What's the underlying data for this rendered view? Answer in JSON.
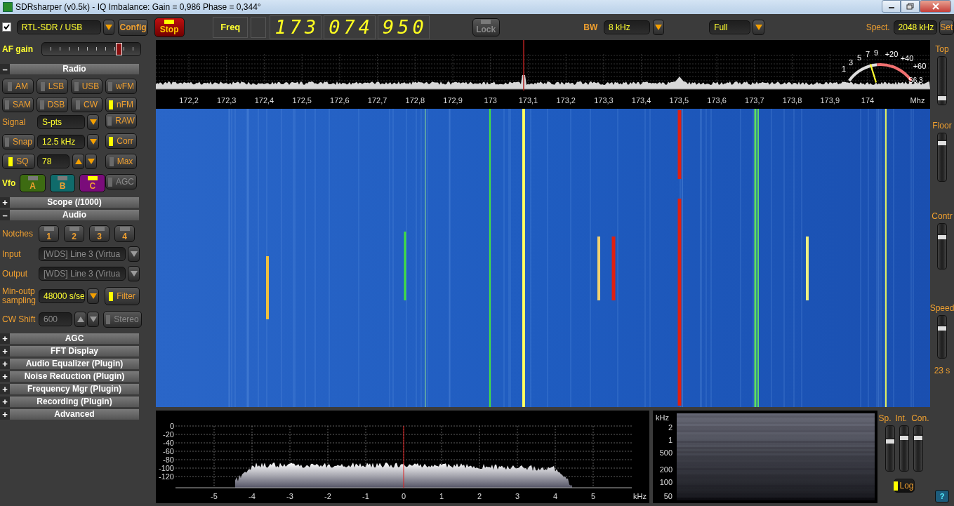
{
  "window": {
    "title": "SDRsharper (v0.5k) - IQ Imbalance: Gain = 0,986 Phase = 0,344°"
  },
  "toolbar": {
    "source_checked": true,
    "source": "RTL-SDR / USB",
    "config": "Config",
    "stop": {
      "label": "Stop",
      "on": true
    },
    "freq_label": "Freq",
    "freq_groups": [
      "173",
      "074",
      "950"
    ],
    "lock": {
      "label": "Lock",
      "disabled": true
    },
    "bw_label": "BW",
    "bw": "8 kHz",
    "zoom": "Full",
    "spect_label": "Spect.",
    "spect": "2048 kHz",
    "set": "Set"
  },
  "af_gain": {
    "label": "AF gain",
    "level": 0.8
  },
  "sections": [
    {
      "toggle": "–",
      "title": "Radio",
      "radio": {
        "modes": [
          {
            "label": "AM",
            "on": false
          },
          {
            "label": "LSB",
            "on": false
          },
          {
            "label": "USB",
            "on": false
          },
          {
            "label": "wFM",
            "on": false
          },
          {
            "label": "SAM",
            "on": false
          },
          {
            "label": "DSB",
            "on": false
          },
          {
            "label": "CW",
            "on": false
          },
          {
            "label": "nFM",
            "on": true
          }
        ],
        "signal": {
          "label": "Signal",
          "value": "S-pts"
        },
        "snap": {
          "label": "Snap",
          "on": false,
          "value": "12.5 kHz"
        },
        "sq": {
          "label": "SQ",
          "on": true,
          "value": "78"
        },
        "side_buttons": [
          {
            "label": "RAW",
            "on": false,
            "disabled": false
          },
          {
            "label": "Corr",
            "on": true,
            "disabled": false
          },
          {
            "label": "Max",
            "on": false,
            "disabled": false
          },
          {
            "label": "AGC",
            "on": false,
            "disabled": true
          }
        ],
        "vfo": {
          "label": "Vfo",
          "buttons": [
            {
              "label": "A",
              "color": "#3d6b12",
              "on": false
            },
            {
              "label": "B",
              "color": "#106b6b",
              "on": false
            },
            {
              "label": "C",
              "color": "#7a0c7a",
              "on": true
            }
          ]
        }
      }
    },
    {
      "toggle": "+",
      "title": "Scope (/1000)"
    },
    {
      "toggle": "–",
      "title": "Audio",
      "audio": {
        "notches": {
          "label": "Notches",
          "buttons": [
            {
              "label": "1",
              "on": false
            },
            {
              "label": "2",
              "on": false
            },
            {
              "label": "3",
              "on": false
            },
            {
              "label": "4",
              "on": false
            }
          ]
        },
        "input": {
          "label": "Input",
          "value": "[WDS] Line 3 (Virtua",
          "disabled": true
        },
        "output": {
          "label": "Output",
          "value": "[WDS] Line 3 (Virtua",
          "disabled": true
        },
        "sampling": {
          "label": "Min-outp sampling",
          "value": "48000 s/se"
        },
        "filter": {
          "label": "Filter",
          "on": true
        },
        "cw_shift": {
          "label": "CW Shift",
          "value": "600",
          "disabled": true
        },
        "stereo": {
          "label": "Stereo",
          "on": false,
          "disabled": true
        }
      }
    },
    {
      "toggle": "+",
      "title": "AGC"
    },
    {
      "toggle": "+",
      "title": "FFT Display"
    },
    {
      "toggle": "+",
      "title": "Audio Equalizer (Plugin)"
    },
    {
      "toggle": "+",
      "title": "Noise Reduction (Plugin)"
    },
    {
      "toggle": "+",
      "title": "Frequency Mgr (Plugin)"
    },
    {
      "toggle": "+",
      "title": "Recording (Plugin)"
    },
    {
      "toggle": "+",
      "title": "Advanced"
    }
  ],
  "spectrum": {
    "x_ticks": [
      "172,2",
      "172,3",
      "172,4",
      "172,5",
      "172,6",
      "172,7",
      "172,8",
      "172,9",
      "173",
      "173,1",
      "173,2",
      "173,3",
      "173,4",
      "173,5",
      "173,6",
      "173,7",
      "173,8",
      "173,9",
      "174"
    ],
    "unit": "Mhz",
    "smeter": {
      "scale": [
        "1",
        "3",
        "5",
        "7",
        "9",
        "+20",
        "+40",
        "+60"
      ],
      "reading": "S6.3"
    }
  },
  "right_strip": {
    "sliders": [
      {
        "label": "Top",
        "level": 0.1
      },
      {
        "label": "Floor",
        "level": 0.85
      },
      {
        "label": "Contr",
        "level": 0.75
      },
      {
        "label": "Speed",
        "level": 0.75
      }
    ],
    "speed_reading": "23 s",
    "help": "?"
  },
  "audio_spectrum": {
    "y_labels": [
      "0",
      "-20",
      "-40",
      "-60",
      "-80",
      "-100",
      "-120"
    ],
    "x_labels": [
      "-5",
      "-4",
      "-3",
      "-2",
      "-1",
      "0",
      "1",
      "2",
      "3",
      "4",
      "5"
    ],
    "unit": "kHz"
  },
  "spectrogram": {
    "unit": "kHz",
    "y_labels": [
      "2",
      "1",
      "500",
      "200",
      "100",
      "50"
    ]
  },
  "audio_controls": {
    "sliders": [
      {
        "label": "Sp.",
        "level": 0.7
      },
      {
        "label": "Int.",
        "level": 0.78
      },
      {
        "label": "Con.",
        "level": 0.78
      }
    ],
    "log": {
      "label": "Log",
      "on": true
    }
  }
}
